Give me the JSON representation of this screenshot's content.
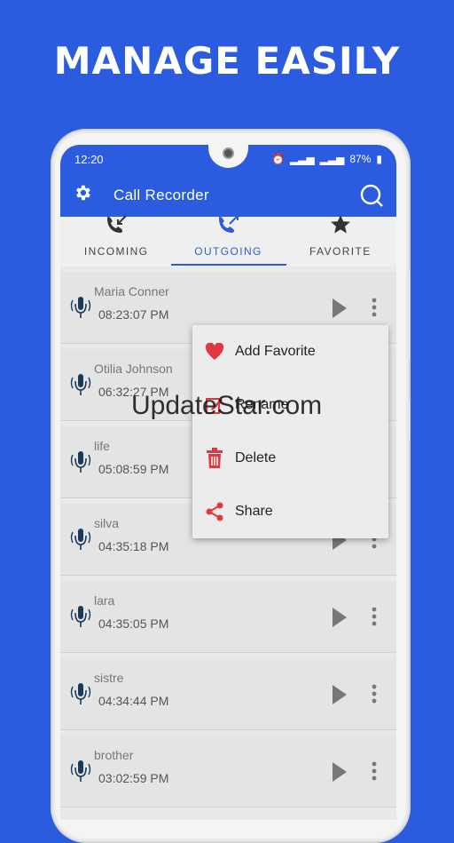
{
  "headline": "MANAGE EASILY",
  "status": {
    "time": "12:20",
    "battery": "87%"
  },
  "appbar": {
    "title": "Call Recorder"
  },
  "tabs": [
    {
      "label": "INCOMING",
      "icon": "incoming-call-icon"
    },
    {
      "label": "OUTGOING",
      "icon": "outgoing-call-icon"
    },
    {
      "label": "FAVORITE",
      "icon": "star-icon"
    }
  ],
  "recordings": [
    {
      "name": "Maria Conner",
      "time": "08:23:07 PM"
    },
    {
      "name": "Otilia Johnson",
      "time": "06:32:27 PM"
    },
    {
      "name": "life",
      "time": "05:08:59 PM"
    },
    {
      "name": "silva",
      "time": "04:35:18 PM"
    },
    {
      "name": "lara",
      "time": "04:35:05 PM"
    },
    {
      "name": "sistre",
      "time": "04:34:44 PM"
    },
    {
      "name": "brother",
      "time": "03:02:59 PM"
    }
  ],
  "menu": {
    "items": [
      {
        "label": "Add Favorite",
        "icon": "heart-icon"
      },
      {
        "label": "Rename",
        "icon": "edit-icon"
      },
      {
        "label": "Delete",
        "icon": "trash-icon"
      },
      {
        "label": "Share",
        "icon": "share-icon"
      }
    ]
  },
  "watermark": "UpdateStar.com",
  "colors": {
    "primary": "#2b5ce0",
    "accent_red": "#e0383e"
  }
}
